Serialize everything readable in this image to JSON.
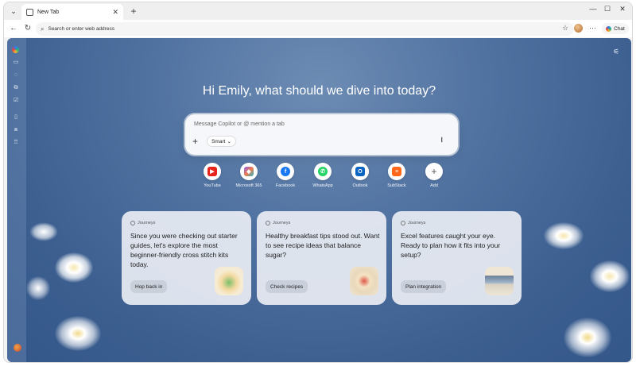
{
  "tabstrip": {
    "tab_title": "New Tab",
    "tab_close": "✕",
    "new_tab": "+",
    "minimize": "—",
    "maximize": "☐",
    "close": "✕"
  },
  "toolbar": {
    "address_placeholder": "Search or enter web address",
    "chat_label": "Chat",
    "more": "···"
  },
  "main": {
    "greeting": "Hi Emily, what should we dive into today?",
    "composer": {
      "placeholder": "Message Copilot or @ mention a tab",
      "mode_label": "Smart"
    },
    "shortcuts": [
      {
        "label": "YouTube",
        "icon": "youtube-icon",
        "color": "#e8231a",
        "glyph": "▶"
      },
      {
        "label": "Microsoft 365",
        "icon": "microsoft-365-icon",
        "color": "#8a5cf6",
        "glyph": "◆"
      },
      {
        "label": "Facebook",
        "icon": "facebook-icon",
        "color": "#1877f2",
        "glyph": "f"
      },
      {
        "label": "WhatsApp",
        "icon": "whatsapp-icon",
        "color": "#25d366",
        "glyph": "✆"
      },
      {
        "label": "Outlook",
        "icon": "outlook-icon",
        "color": "#0a64c2",
        "glyph": "O"
      },
      {
        "label": "SubStack",
        "icon": "substack-icon",
        "color": "#ff6719",
        "glyph": "≡"
      },
      {
        "label": "Add",
        "icon": "add-icon",
        "color": "#555555",
        "glyph": "+"
      }
    ],
    "cards": [
      {
        "tag": "Journeys",
        "text": "Since you were checking out starter guides, let's explore the most beginner-friendly cross stitch kits today.",
        "button": "Hop back in"
      },
      {
        "tag": "Journeys",
        "text": "Healthy breakfast tips stood out. Want to see recipe ideas that balance sugar?",
        "button": "Check recipes"
      },
      {
        "tag": "Journeys",
        "text": "Excel features caught your eye. Ready to plan how it fits into your setup?",
        "button": "Plan integration"
      }
    ]
  },
  "colors": {
    "background": "#4f71a0",
    "card": "#e8ecf3"
  }
}
